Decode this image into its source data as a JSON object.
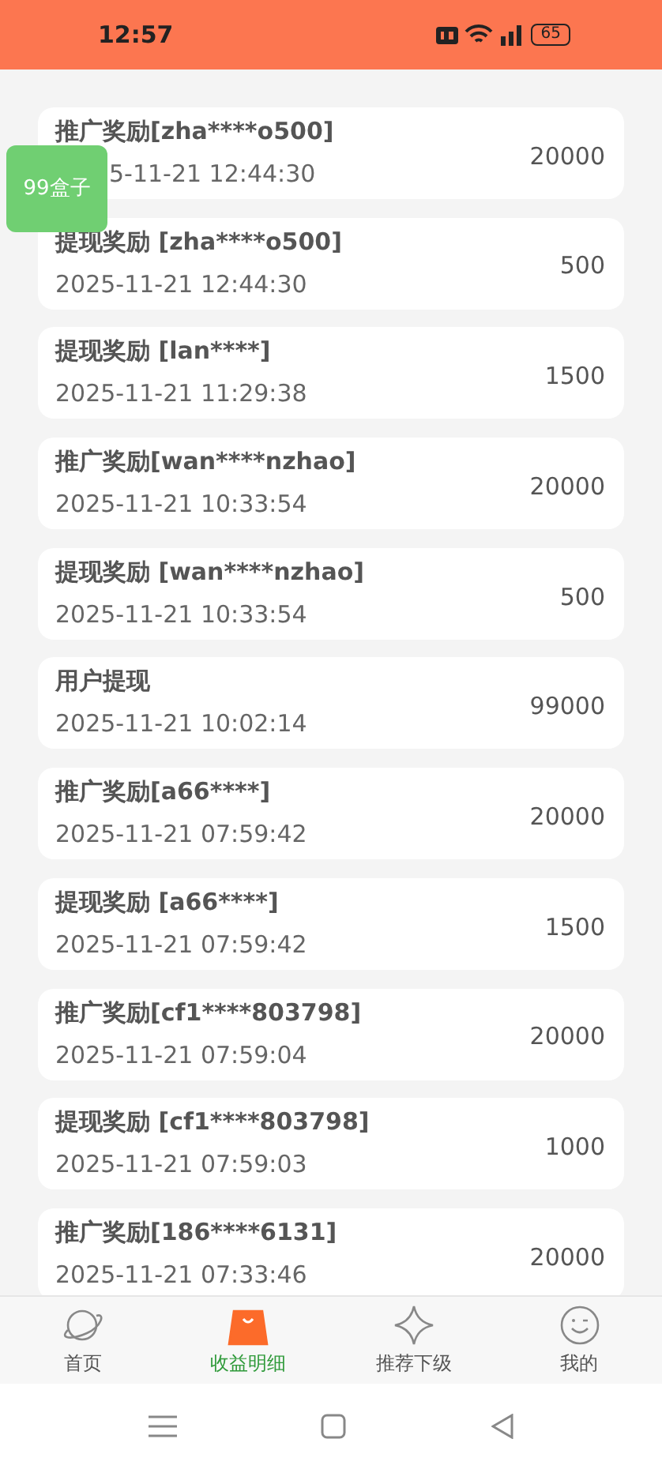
{
  "status_bar": {
    "time": "12:57",
    "battery": "65"
  },
  "floating_badge": "99盒子",
  "records": [
    {
      "title": "推广奖励[zha****o500]",
      "date": "5-11-21 12:44:30",
      "amount": "20000",
      "date_covered": true
    },
    {
      "title": "提现奖励 [zha****o500]",
      "date": "2025-11-21 12:44:30",
      "amount": "500"
    },
    {
      "title": "提现奖励 [lan****]",
      "date": "2025-11-21 11:29:38",
      "amount": "1500"
    },
    {
      "title": "推广奖励[wan****nzhao]",
      "date": "2025-11-21 10:33:54",
      "amount": "20000"
    },
    {
      "title": "提现奖励 [wan****nzhao]",
      "date": "2025-11-21 10:33:54",
      "amount": "500"
    },
    {
      "title": "用户提现",
      "date": "2025-11-21 10:02:14",
      "amount": "99000"
    },
    {
      "title": "推广奖励[a66****]",
      "date": "2025-11-21 07:59:42",
      "amount": "20000"
    },
    {
      "title": "提现奖励 [a66****]",
      "date": "2025-11-21 07:59:42",
      "amount": "1500"
    },
    {
      "title": "推广奖励[cf1****803798]",
      "date": "2025-11-21 07:59:04",
      "amount": "20000"
    },
    {
      "title": "提现奖励 [cf1****803798]",
      "date": "2025-11-21 07:59:03",
      "amount": "1000"
    },
    {
      "title": "推广奖励[186****6131]",
      "date": "2025-11-21 07:33:46",
      "amount": "20000"
    }
  ],
  "bottom_nav": [
    {
      "label": "首页",
      "selected": false
    },
    {
      "label": "收益明细",
      "selected": true
    },
    {
      "label": "推荐下级",
      "selected": false
    },
    {
      "label": "我的",
      "selected": false
    }
  ]
}
